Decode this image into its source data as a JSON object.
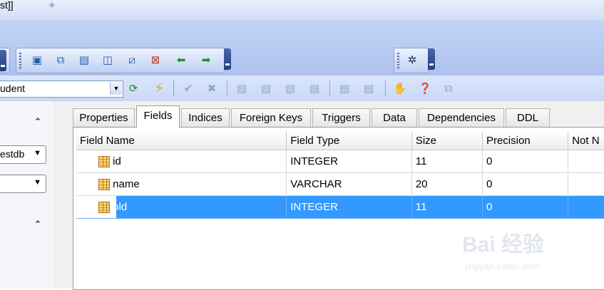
{
  "window": {
    "title_fragment": "st]]"
  },
  "toolbar_left": {
    "icons": [
      "new-table-icon",
      "copy-icon",
      "table-layout-icon",
      "split-view-icon",
      "edit-icon",
      "delete-icon",
      "back-icon",
      "forward-icon"
    ]
  },
  "toolbar_right": {
    "icons": [
      "settings-gear-icon"
    ]
  },
  "object_combo": {
    "value": "udent"
  },
  "toolbar2": {
    "icons": [
      "refresh-icon",
      "execute-icon",
      "commit-icon",
      "rollback-icon",
      "field-insert-icon",
      "field-delete-icon",
      "field-up-icon",
      "field-down-icon",
      "field-left-icon",
      "field-right-icon",
      "hand-icon",
      "help-icon",
      "window-icon"
    ]
  },
  "left_pane": {
    "db_combo": "estdb",
    "second_combo": ""
  },
  "tabs": [
    {
      "label": "Properties"
    },
    {
      "label": "Fields",
      "active": true
    },
    {
      "label": "Indices"
    },
    {
      "label": "Foreign Keys"
    },
    {
      "label": "Triggers"
    },
    {
      "label": "Data"
    },
    {
      "label": "Dependencies"
    },
    {
      "label": "DDL"
    }
  ],
  "grid": {
    "headers": [
      "Field Name",
      "Field Type",
      "Size",
      "Precision",
      "Not N"
    ],
    "rows": [
      {
        "name": "id",
        "type": "INTEGER",
        "size": "11",
        "precision": "0",
        "notnull": ""
      },
      {
        "name": "name",
        "type": "VARCHAR",
        "size": "20",
        "precision": "0",
        "notnull": ""
      },
      {
        "name": "old",
        "type": "INTEGER",
        "size": "11",
        "precision": "0",
        "notnull": "",
        "selected": true
      }
    ]
  },
  "watermark": {
    "line1": "Bai 经验",
    "line2": "jingyan.baidu.com"
  }
}
